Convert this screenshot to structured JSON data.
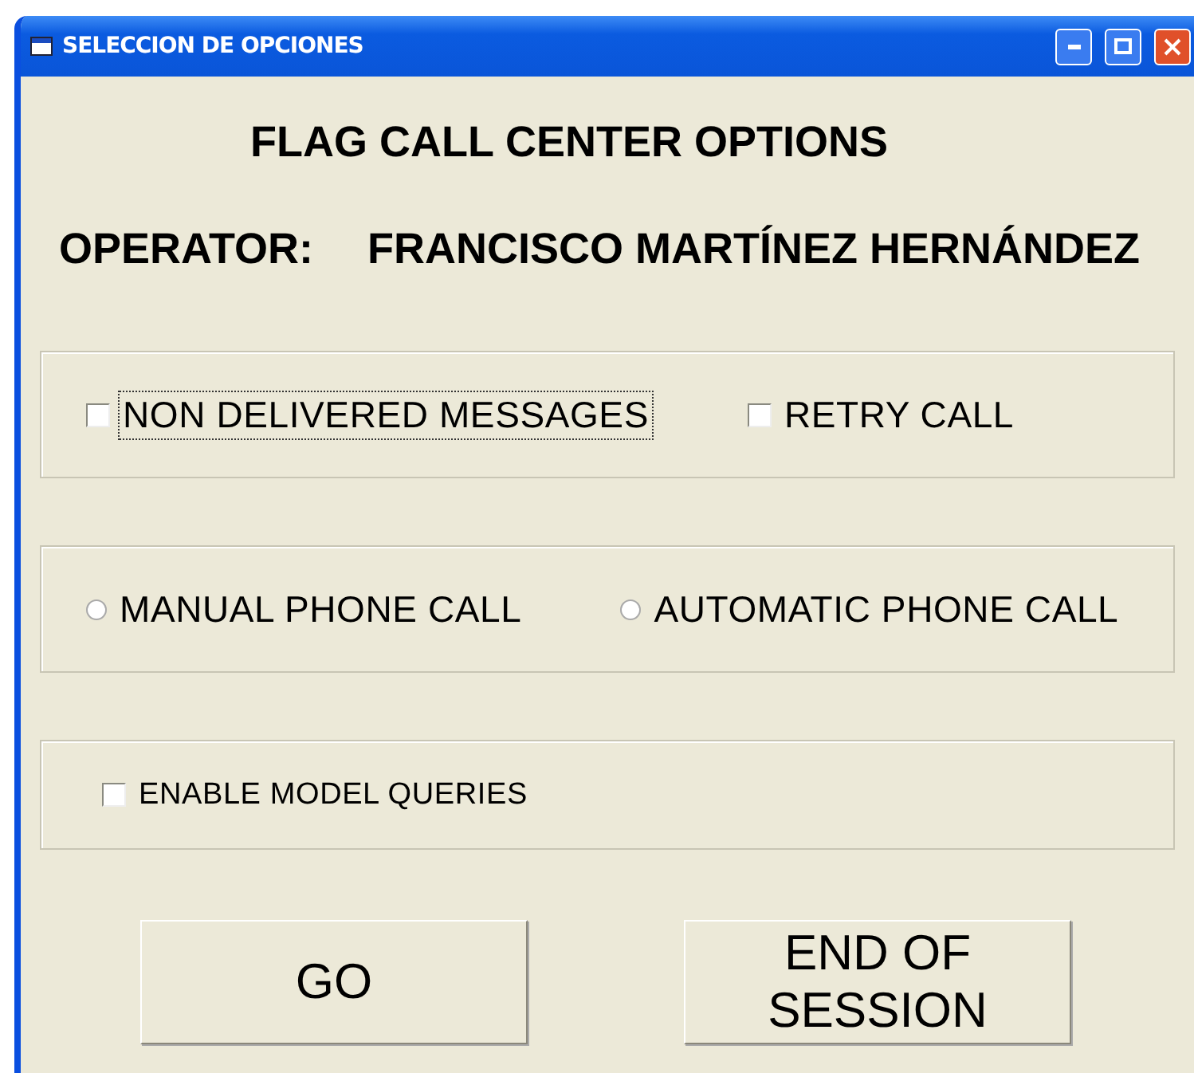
{
  "window": {
    "title": "SELECCION DE OPCIONES"
  },
  "heading": "FLAG CALL CENTER OPTIONS",
  "operator": {
    "label": "OPERATOR:",
    "name": "FRANCISCO MARTÍNEZ HERNÁNDEZ"
  },
  "groups": [
    {
      "items": [
        {
          "kind": "checkbox",
          "label": "NON DELIVERED MESSAGES",
          "checked": false,
          "focused": true
        },
        {
          "kind": "checkbox",
          "label": "RETRY CALL",
          "checked": false,
          "focused": false
        }
      ]
    },
    {
      "items": [
        {
          "kind": "radio",
          "label": "MANUAL PHONE CALL",
          "selected": false
        },
        {
          "kind": "radio",
          "label": "AUTOMATIC PHONE CALL",
          "selected": false
        }
      ]
    },
    {
      "items": [
        {
          "kind": "small-checkbox",
          "label": "ENABLE MODEL QUERIES",
          "checked": false,
          "focused": false
        }
      ]
    }
  ],
  "buttons": [
    {
      "label": "GO"
    },
    {
      "label": "END OF SESSION"
    }
  ]
}
